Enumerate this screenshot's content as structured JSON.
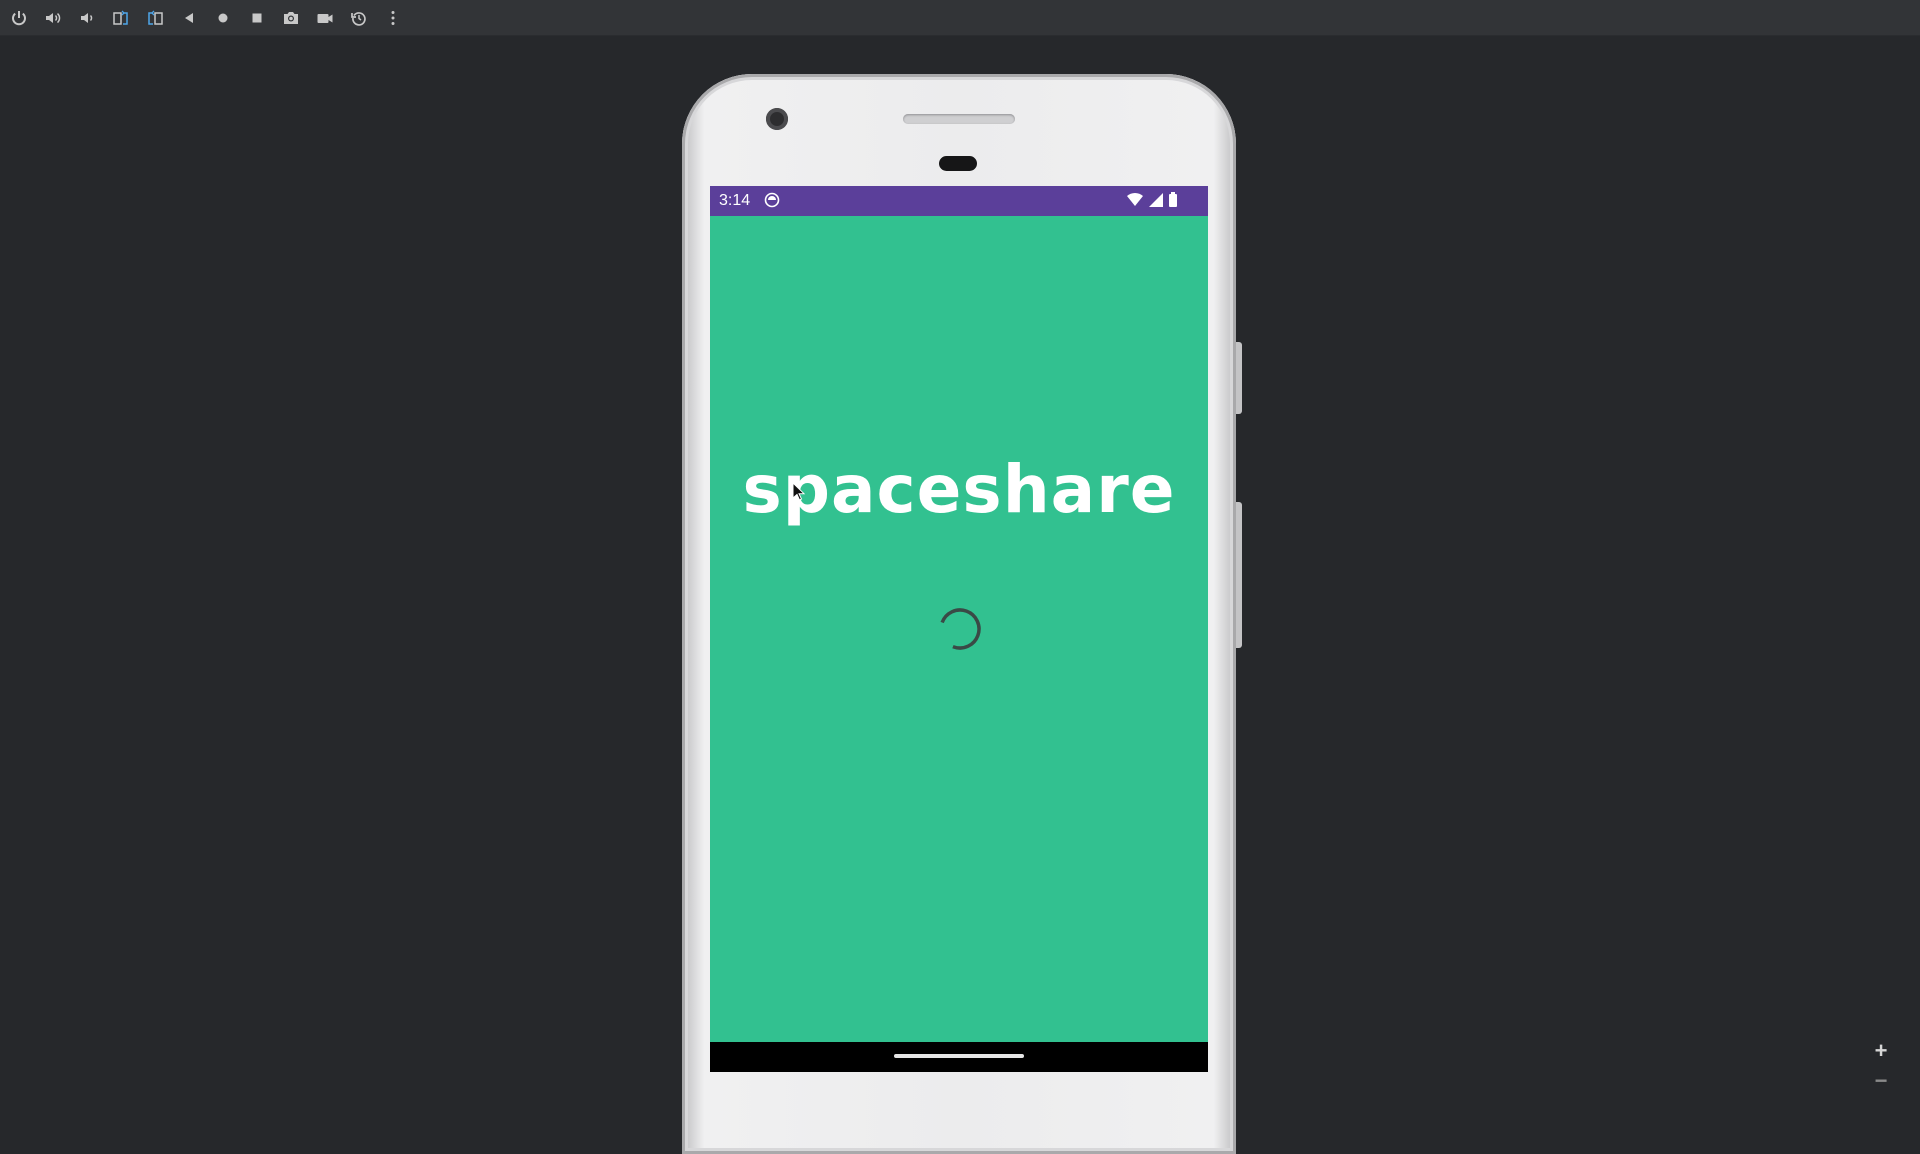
{
  "toolbar": {
    "buttons": [
      {
        "icon": "power-icon",
        "label": "Power"
      },
      {
        "icon": "volume-up-icon",
        "label": "Volume up"
      },
      {
        "icon": "volume-down-icon",
        "label": "Volume down"
      },
      {
        "icon": "rotate-left-icon",
        "label": "Rotate left"
      },
      {
        "icon": "rotate-right-icon",
        "label": "Rotate right"
      },
      {
        "icon": "back-icon",
        "label": "Back"
      },
      {
        "icon": "home-icon",
        "label": "Home"
      },
      {
        "icon": "overview-icon",
        "label": "Overview"
      },
      {
        "icon": "camera-icon",
        "label": "Take screenshot"
      },
      {
        "icon": "video-camera-icon",
        "label": "Screen record"
      },
      {
        "icon": "snapshot-restore-icon",
        "label": "Snapshots"
      },
      {
        "icon": "more-vertical-icon",
        "label": "More"
      }
    ],
    "accent_color": "#4ea6ea"
  },
  "device": {
    "status_bar": {
      "time": "3:14",
      "color": "#5b3f9a",
      "icons": [
        "sync-icon",
        "wifi-icon",
        "signal-icon",
        "battery-icon"
      ]
    },
    "app": {
      "logo_text": "spaceshare",
      "background": "#32c190",
      "loading": true
    }
  },
  "zoom": {
    "zoom_in": "+",
    "zoom_out": "−"
  }
}
